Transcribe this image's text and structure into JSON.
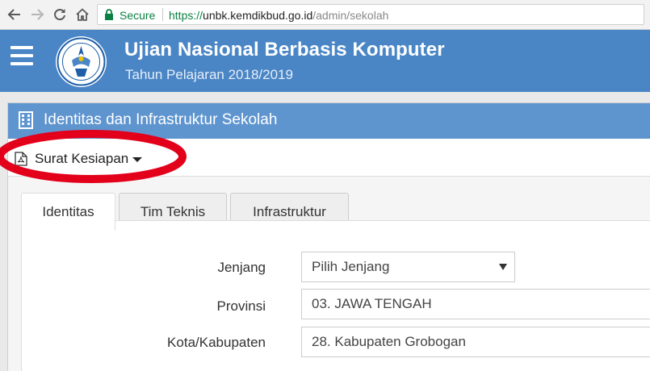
{
  "browser": {
    "secure_label": "Secure",
    "url_scheme": "https://",
    "url_host": "unbk.kemdikbud.go.id",
    "url_path": "/admin/sekolah",
    "icons": [
      "back-icon",
      "forward-icon",
      "reload-icon",
      "home-icon",
      "lock-icon"
    ]
  },
  "header": {
    "title": "Ujian Nasional Berbasis Komputer",
    "subtitle": "Tahun Pelajaran 2018/2019",
    "background": "#4a86c6"
  },
  "panel": {
    "title": "Identitas dan Infrastruktur Sekolah",
    "heading_color": "#5f95cf"
  },
  "toolbar": {
    "dropdown_label": "Surat Kesiapan",
    "highlight_color": "#e3001b"
  },
  "tabs": [
    {
      "label": "Identitas",
      "active": true
    },
    {
      "label": "Tim Teknis",
      "active": false
    },
    {
      "label": "Infrastruktur",
      "active": false
    }
  ],
  "form": {
    "jenjang": {
      "label": "Jenjang",
      "value": "Pilih Jenjang"
    },
    "provinsi": {
      "label": "Provinsi",
      "value": "03. JAWA TENGAH"
    },
    "kota": {
      "label": "Kota/Kabupaten",
      "value": "28. Kabupaten Grobogan"
    }
  }
}
